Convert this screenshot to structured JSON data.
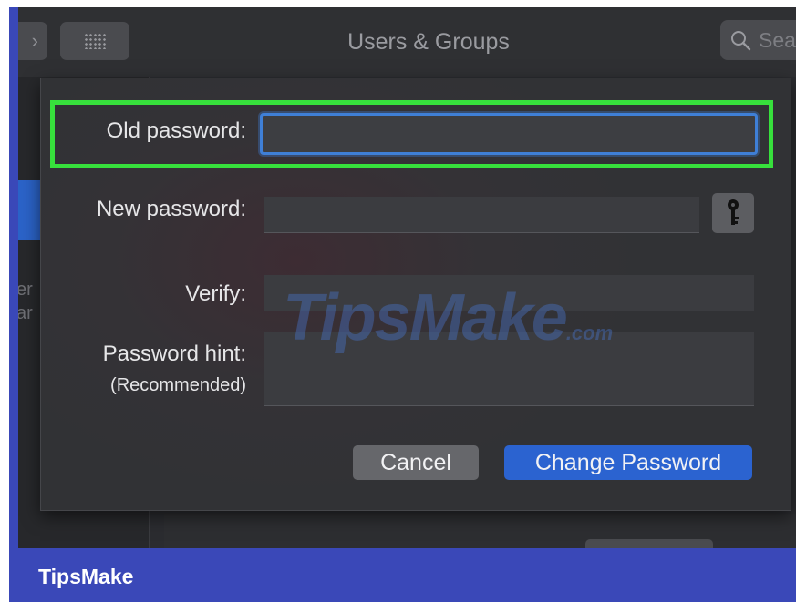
{
  "window": {
    "title": "Users & Groups",
    "search_placeholder": "Sea"
  },
  "sidebar": {
    "fragment_lines": [
      "er",
      "ar"
    ]
  },
  "dialog": {
    "old_password_label": "Old password:",
    "new_password_label": "New password:",
    "verify_label": "Verify:",
    "hint_label": "Password hint:",
    "hint_sub_label": "(Recommended)",
    "old_password_value": "",
    "new_password_value": "",
    "verify_value": "",
    "hint_value": "",
    "cancel_label": "Cancel",
    "change_label": "Change Password"
  },
  "icons": {
    "back": "chevron-left-icon",
    "grid": "grid-icon",
    "search": "search-icon",
    "key": "key-icon"
  },
  "colors": {
    "highlight": "#37e03c",
    "primary_button": "#2b63d0",
    "frame": "#3a48b8"
  },
  "watermark": {
    "text": "TipsMake",
    "suffix": ".com"
  },
  "brand": {
    "text": "TipsMake"
  }
}
